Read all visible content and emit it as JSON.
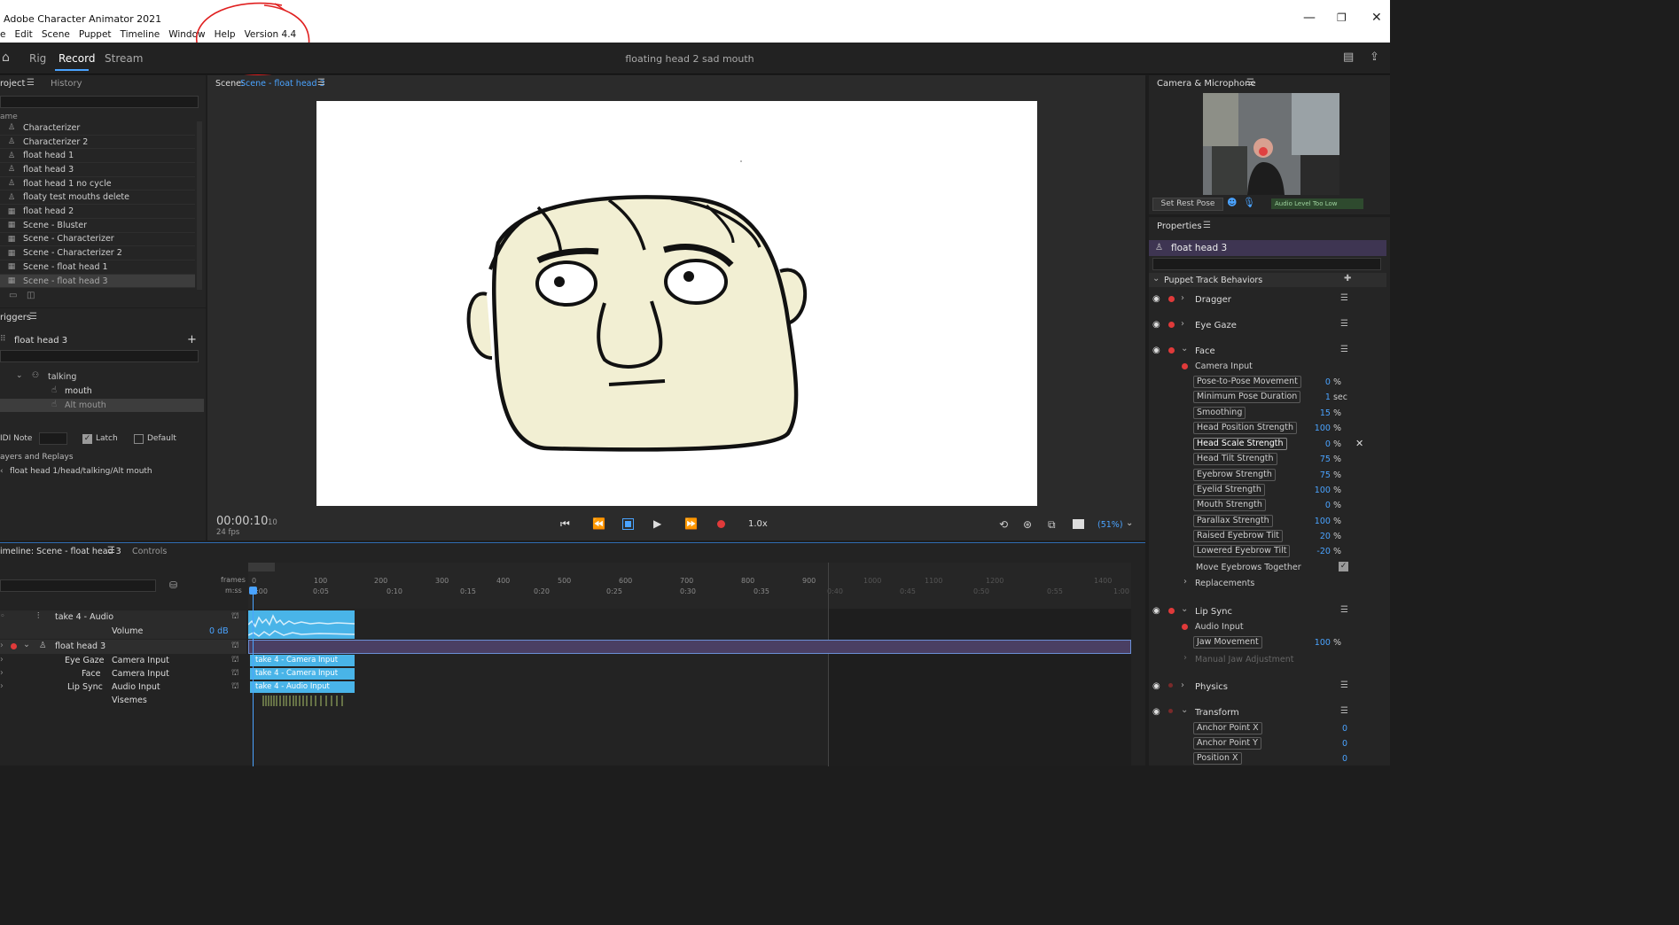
{
  "app": {
    "title": "Adobe Character Animator 2021",
    "menu": [
      "e",
      "Edit",
      "Scene",
      "Puppet",
      "Timeline",
      "Window",
      "Help",
      "Version 4.4"
    ]
  },
  "workspace": {
    "tabs": [
      "Rig",
      "Record",
      "Stream"
    ],
    "active_tab": "Record",
    "doc_title": "floating head 2 sad mouth"
  },
  "project": {
    "tabs": [
      "roject",
      "History"
    ],
    "column": "ame",
    "items": [
      {
        "icon": "puppet-icon",
        "label": "Characterizer"
      },
      {
        "icon": "puppet-icon",
        "label": "Characterizer 2"
      },
      {
        "icon": "puppet-icon",
        "label": "float head 1"
      },
      {
        "icon": "puppet-icon",
        "label": "float head 3"
      },
      {
        "icon": "puppet-icon",
        "label": "float head 1 no cycle"
      },
      {
        "icon": "puppet-icon",
        "label": "floaty test mouths delete"
      },
      {
        "icon": "scene-icon",
        "label": "float head 2"
      },
      {
        "icon": "scene-icon",
        "label": "Scene - Bluster"
      },
      {
        "icon": "scene-icon",
        "label": "Scene - Characterizer"
      },
      {
        "icon": "scene-icon",
        "label": "Scene - Characterizer 2"
      },
      {
        "icon": "scene-icon",
        "label": "Scene - float head 1"
      },
      {
        "icon": "scene-icon",
        "label": "Scene - float head 3"
      }
    ]
  },
  "triggers": {
    "header": "riggers",
    "puppet": "float head 3",
    "group": "talking",
    "items": [
      "mouth",
      "Alt mouth"
    ],
    "midi_label": "IDI Note",
    "latch_label": "Latch",
    "default_label": "Default",
    "swap_header": "ayers and Replays",
    "path": "float head 1/head/talking/Alt mouth"
  },
  "scene": {
    "label": "Scene:",
    "name": "Scene - float head 3",
    "timecode": "00:00:10",
    "frame": "10",
    "fps": "24 fps",
    "speed": "1.0x",
    "zoom": "(51%)"
  },
  "camera": {
    "header": "Camera & Microphone",
    "rest_pose": "Set Rest Pose",
    "audio_level": "Audio Level Too Low"
  },
  "properties": {
    "header": "Properties",
    "puppet": "float head 3",
    "section": "Puppet Track Behaviors",
    "behaviors": [
      "Dragger",
      "Eye Gaze",
      "Face",
      "Lip Sync",
      "Physics",
      "Transform"
    ],
    "face_input": "Camera Input",
    "face_params": [
      {
        "label": "Pose-to-Pose Movement",
        "value": "0",
        "unit": "%"
      },
      {
        "label": "Minimum Pose Duration",
        "value": "1",
        "unit": "sec"
      },
      {
        "label": "Smoothing",
        "value": "15",
        "unit": "%"
      },
      {
        "label": "Head Position Strength",
        "value": "100",
        "unit": "%"
      },
      {
        "label": "Head Scale Strength",
        "value": "0",
        "unit": "%"
      },
      {
        "label": "Head Tilt Strength",
        "value": "75",
        "unit": "%"
      },
      {
        "label": "Eyebrow Strength",
        "value": "75",
        "unit": "%"
      },
      {
        "label": "Eyelid Strength",
        "value": "100",
        "unit": "%"
      },
      {
        "label": "Mouth Strength",
        "value": "0",
        "unit": "%"
      },
      {
        "label": "Parallax Strength",
        "value": "100",
        "unit": "%"
      },
      {
        "label": "Raised Eyebrow Tilt",
        "value": "20",
        "unit": "%"
      },
      {
        "label": "Lowered Eyebrow Tilt",
        "value": "-20",
        "unit": "%"
      }
    ],
    "move_eyebrows": "Move Eyebrows Together",
    "replacements": "Replacements",
    "lip_input": "Audio Input",
    "jaw_label": "Jaw Movement",
    "jaw_value": "100",
    "jaw_unit": "%",
    "manual_jaw": "Manual Jaw Adjustment",
    "transform_params": [
      {
        "label": "Anchor Point X",
        "value": "0"
      },
      {
        "label": "Anchor Point Y",
        "value": "0"
      },
      {
        "label": "Position X",
        "value": "0"
      }
    ]
  },
  "timeline": {
    "tab": "imeline: Scene - float head 3",
    "tab2": "Controls",
    "frames_label": "frames",
    "mss_label": "m:ss",
    "frame_ticks": [
      "0",
      "100",
      "200",
      "300",
      "400",
      "500",
      "600",
      "700",
      "800",
      "900",
      "1000",
      "1100",
      "1200",
      "1400"
    ],
    "time_ticks": [
      "0:00",
      "0:05",
      "0:10",
      "0:15",
      "0:20",
      "0:25",
      "0:30",
      "0:35",
      "0:40",
      "0:45",
      "0:50",
      "0:55",
      "1:00"
    ],
    "audio_track": "take 4 - Audio",
    "volume_label": "Volume",
    "volume_value": "0 dB",
    "puppet_track": "float head 3",
    "subtracks": [
      {
        "behavior": "Eye Gaze",
        "input": "Camera Input",
        "clip": "take 4 - Camera Input"
      },
      {
        "behavior": "Face",
        "input": "Camera Input",
        "clip": "take 4 - Camera Input"
      },
      {
        "behavior": "Lip Sync",
        "input": "Audio Input",
        "clip": "take 4 - Audio Input"
      }
    ],
    "visemes_label": "Visemes"
  }
}
